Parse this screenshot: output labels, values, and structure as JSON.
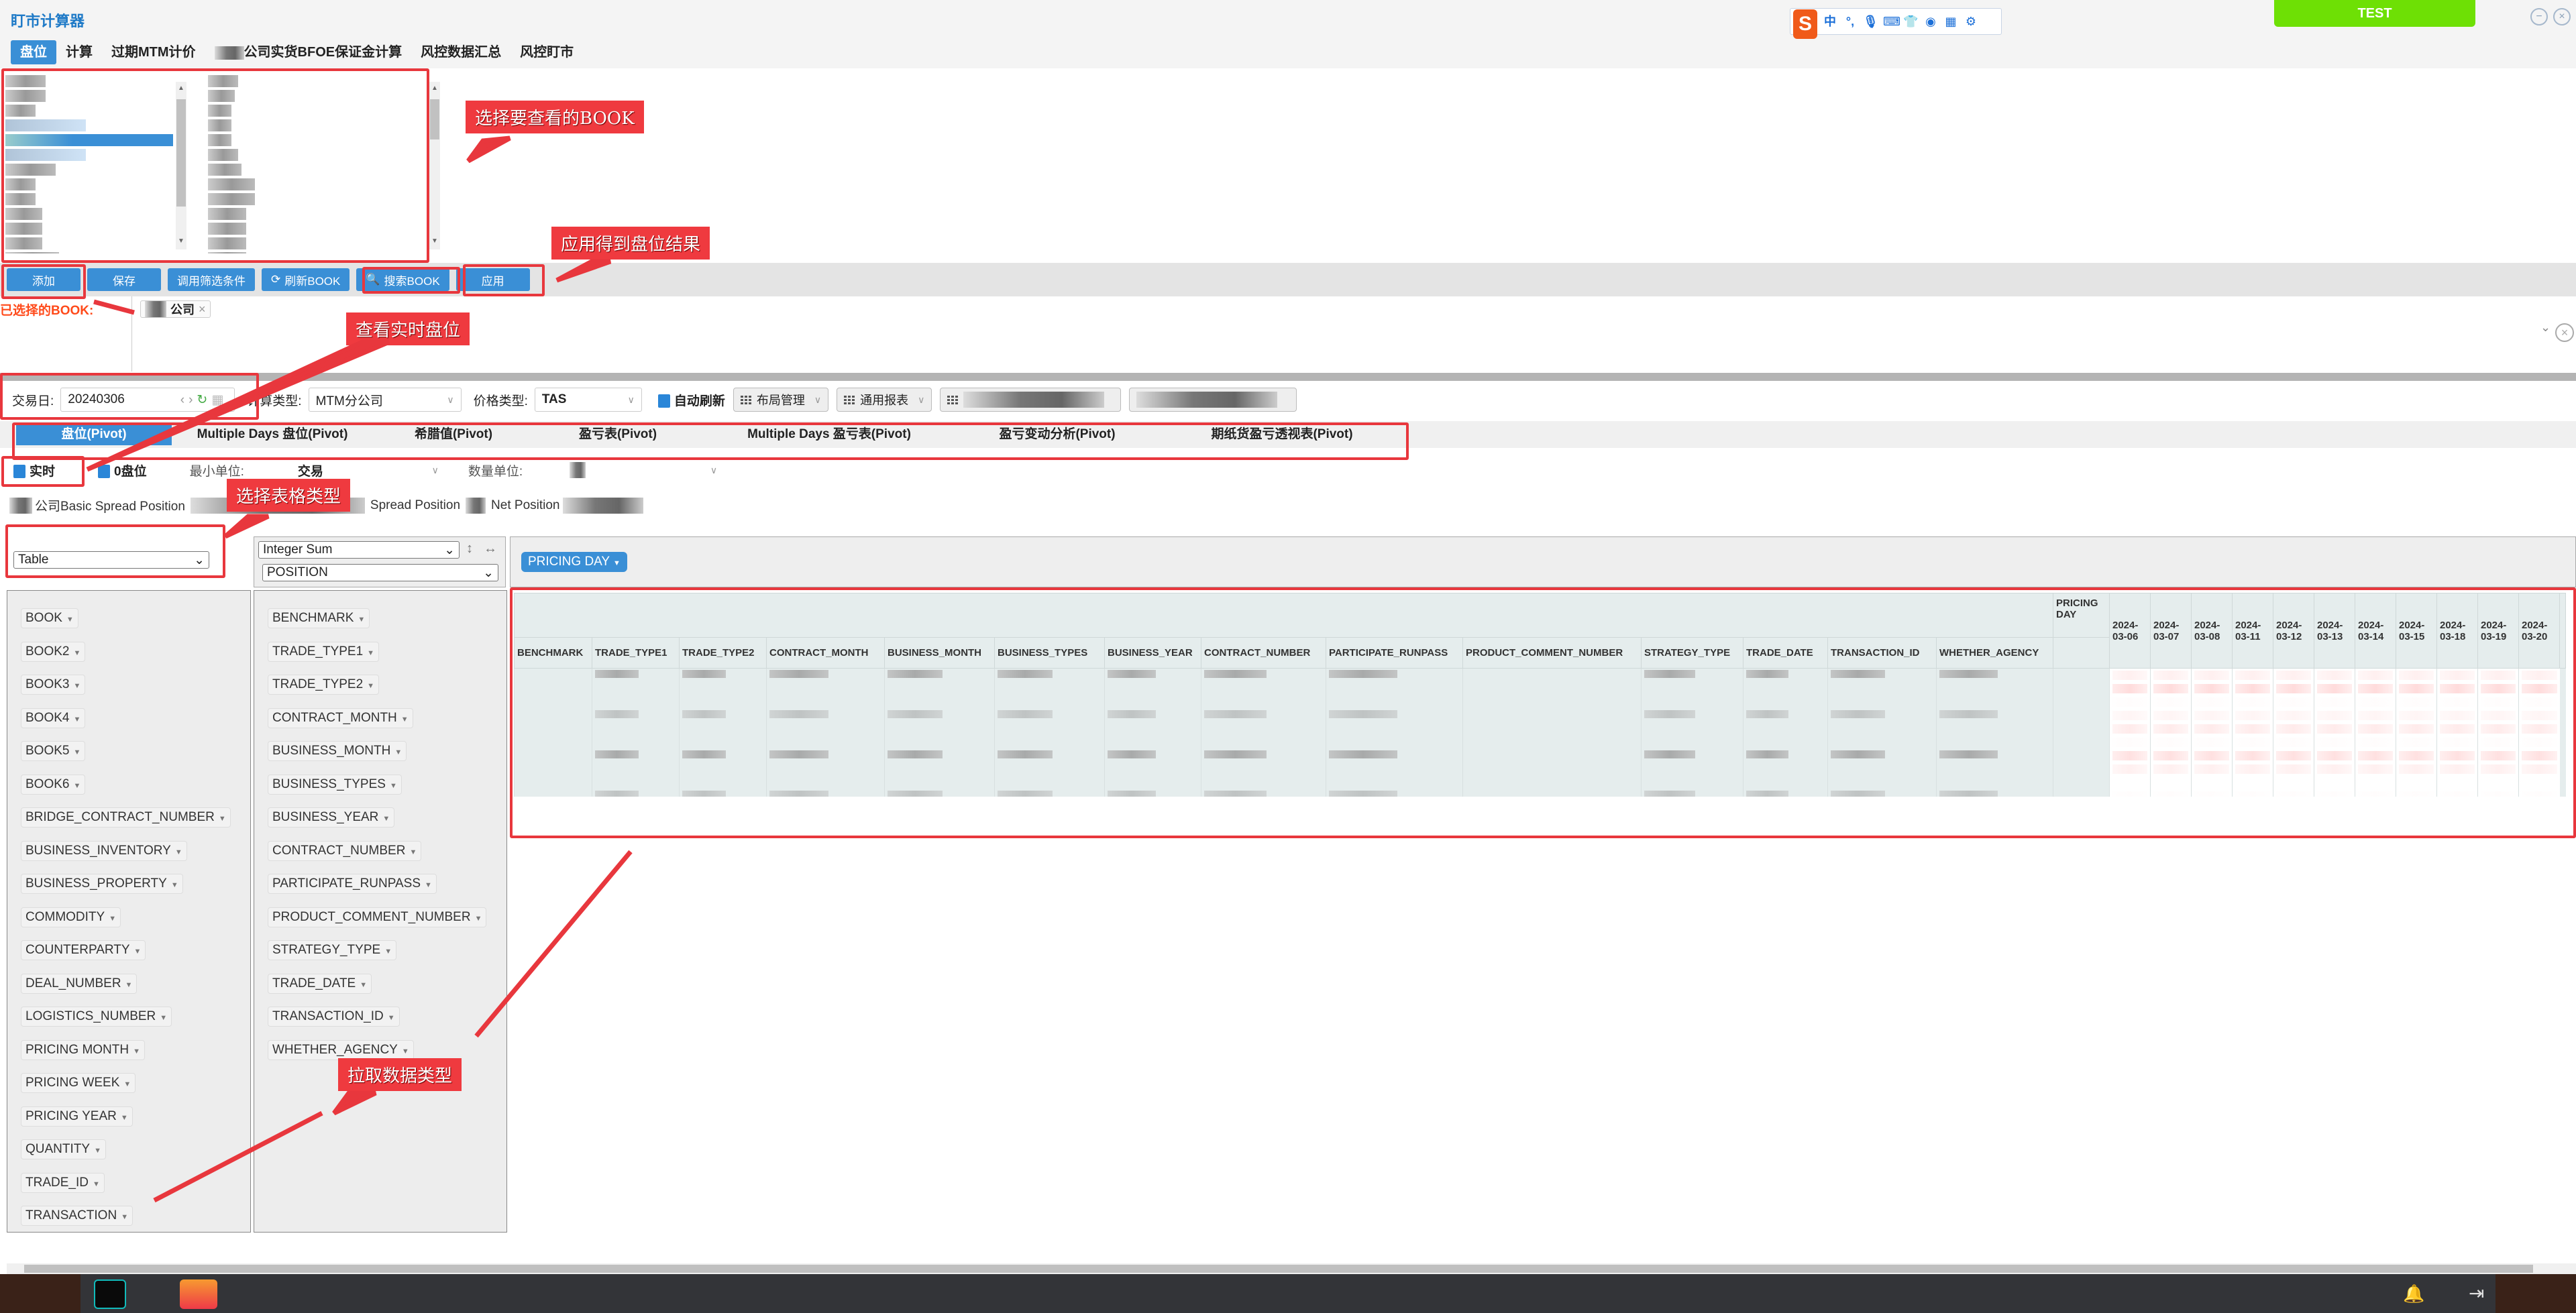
{
  "app": {
    "title": "盯市计算器",
    "test_badge": "TEST"
  },
  "nav": {
    "tabs": [
      {
        "label": "盘位",
        "active": true
      },
      {
        "label": "计算"
      },
      {
        "label": "过期MTM计价"
      },
      {
        "label": "公司实货BFOE保证金计算"
      },
      {
        "label": "风控数据汇总"
      },
      {
        "label": "风控盯市"
      }
    ]
  },
  "ime_toolbar": {
    "logo": "S",
    "icons": [
      "中",
      "°,",
      "mic-icon",
      "keyboard-icon",
      "skin-icon",
      "game-icon",
      "apps-icon",
      "settings-icon"
    ]
  },
  "toolbar": {
    "add": "添加",
    "save": "保存",
    "load_filter": "调用筛选条件",
    "refresh_book": "刷新BOOK",
    "search_book": "搜索BOOK",
    "apply": "应用"
  },
  "selected_books": {
    "label": "已选择的BOOK:",
    "chips": [
      {
        "label": "公司"
      }
    ]
  },
  "filters": {
    "trade_date_label": "交易日:",
    "trade_date": "20240306",
    "calc_type_label": "计算类型:",
    "calc_type": "MTM分公司",
    "price_type_label": "价格类型:",
    "price_type": "TAS",
    "auto_refresh": "自动刷新",
    "layout_mgmt": "布局管理",
    "general_report": "通用报表"
  },
  "report_tabs": [
    {
      "label": "盘位(Pivot)",
      "active": true
    },
    {
      "label": "Multiple Days 盘位(Pivot)"
    },
    {
      "label": "希腊值(Pivot)"
    },
    {
      "label": "盈亏表(Pivot)"
    },
    {
      "label": "Multiple Days 盈亏表(Pivot)"
    },
    {
      "label": "盈亏变动分析(Pivot)"
    },
    {
      "label": "期纸货盈亏透视表(Pivot)"
    }
  ],
  "options": {
    "realtime": "实时",
    "zero_position": "0盘位",
    "min_unit_label": "最小单位:",
    "min_unit": "交易",
    "qty_unit_label": "数量单位:"
  },
  "info": {
    "basic_spread": "公司Basic Spread Position",
    "spread": "Spread Position",
    "net": "Net Position"
  },
  "pivot": {
    "renderer": "Table",
    "aggregator": "Integer Sum",
    "value_field": "POSITION",
    "col_field": "PRICING DAY",
    "unused_fields_left": [
      "BOOK",
      "BOOK2",
      "BOOK3",
      "BOOK4",
      "BOOK5",
      "BOOK6",
      "BRIDGE_CONTRACT_NUMBER",
      "BUSINESS_INVENTORY",
      "BUSINESS_PROPERTY",
      "COMMODITY",
      "COUNTERPARTY",
      "DEAL_NUMBER",
      "LOGISTICS_NUMBER",
      "PRICING MONTH",
      "PRICING WEEK",
      "PRICING YEAR",
      "QUANTITY",
      "TRADE_ID",
      "TRANSACTION"
    ],
    "row_fields": [
      "BENCHMARK",
      "TRADE_TYPE1",
      "TRADE_TYPE2",
      "CONTRACT_MONTH",
      "BUSINESS_MONTH",
      "BUSINESS_TYPES",
      "BUSINESS_YEAR",
      "CONTRACT_NUMBER",
      "PARTICIPATE_RUNPASS",
      "PRODUCT_COMMENT_NUMBER",
      "STRATEGY_TYPE",
      "TRADE_DATE",
      "TRANSACTION_ID",
      "WHETHER_AGENCY"
    ],
    "table_col_label": "PRICING DAY",
    "dates": [
      "2024-03-06",
      "2024-03-07",
      "2024-03-08",
      "2024-03-11",
      "2024-03-12",
      "2024-03-13",
      "2024-03-14",
      "2024-03-15",
      "2024-03-18",
      "2024-03-19",
      "2024-03-20"
    ]
  },
  "annotations": [
    "选择要查看的BOOK",
    "应用得到盘位结果",
    "查看实时盘位",
    "选择表格类型",
    "拉取数据类型"
  ]
}
